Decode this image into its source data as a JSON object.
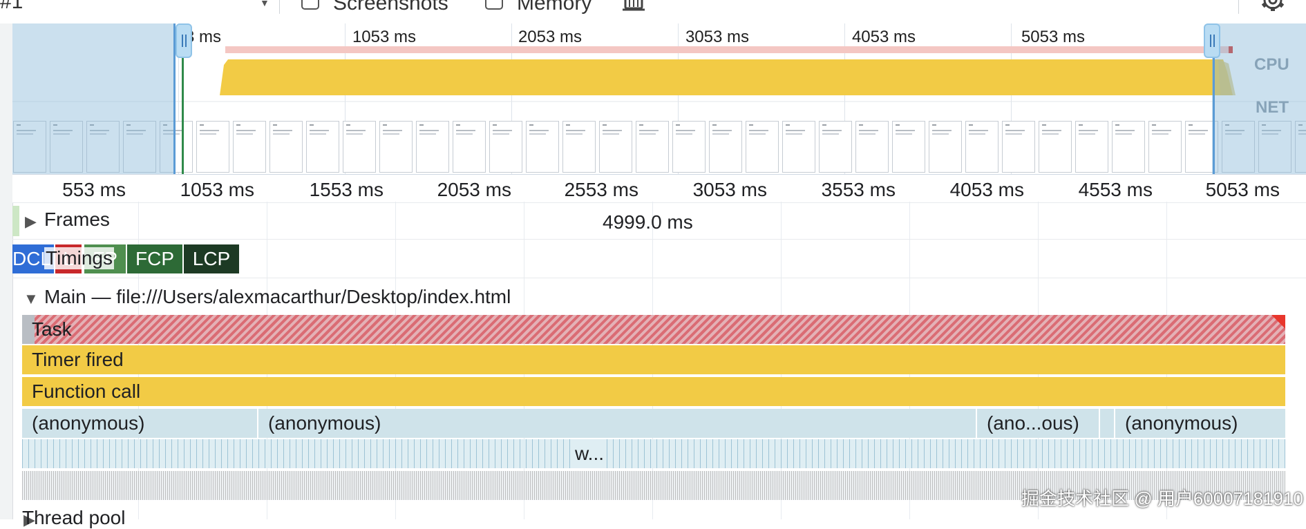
{
  "toolbar": {
    "selector_value": "#1",
    "checkboxes": [
      {
        "label": "Screenshots",
        "checked": false
      },
      {
        "label": "Memory",
        "checked": false
      }
    ],
    "icons": [
      "collect-garbage-icon",
      "settings-gear-icon"
    ]
  },
  "overview": {
    "time_labels": [
      "53 ms",
      "1053 ms",
      "2053 ms",
      "3053 ms",
      "4053 ms",
      "5053 ms"
    ],
    "cpu_label": "CPU",
    "net_label": "NET",
    "colors": {
      "cpu_scripting": "#f2cb45",
      "long_task": "#f4c7c3",
      "selection": "#8fc3e8"
    }
  },
  "ruler": {
    "labels": [
      "553 ms",
      "1053 ms",
      "1553 ms",
      "2053 ms",
      "2553 ms",
      "3053 ms",
      "3553 ms",
      "4053 ms",
      "4553 ms",
      "5053 ms"
    ]
  },
  "tracks": {
    "frames": {
      "title": "Frames",
      "duration": "4999.0 ms"
    },
    "timings": {
      "title": "Timings",
      "markers": [
        {
          "label": "DCL",
          "color": "#2f6dd6"
        },
        {
          "label": "L",
          "color": "#c8282b"
        },
        {
          "label": "FP",
          "color": "#4f8f4f"
        },
        {
          "label": "FCP",
          "color": "#2d6a36"
        },
        {
          "label": "LCP",
          "color": "#1d3a24"
        }
      ]
    },
    "main": {
      "title": "Main — file:///Users/alexmacarthur/Desktop/index.html",
      "rows": {
        "task": "Task",
        "timer": "Timer fired",
        "function": "Function call",
        "anonymous": [
          "(anonymous)",
          "(anonymous)",
          "(ano...ous)",
          "(anonymous)"
        ],
        "deep": "w..."
      }
    },
    "thread_pool": "Thread pool"
  },
  "watermark": "掘金技术社区 @ 用户60007181910"
}
